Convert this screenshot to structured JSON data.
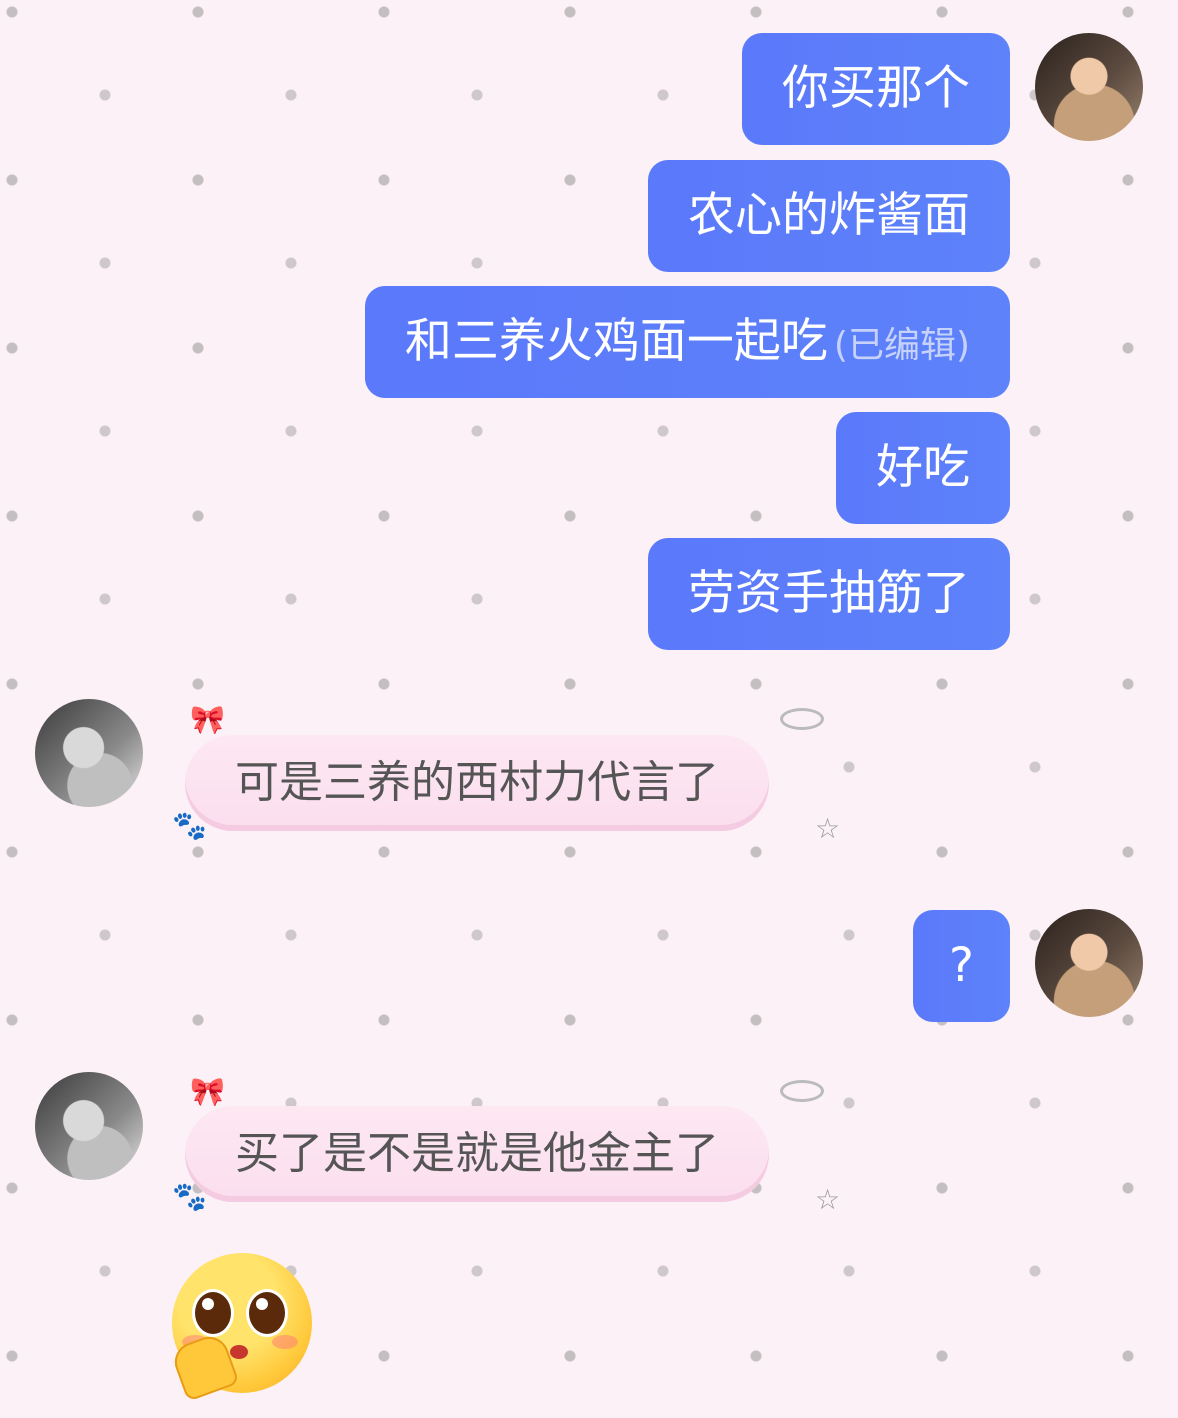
{
  "conversation": {
    "outgoing": [
      {
        "text": "你买那个"
      },
      {
        "text": "农心的炸酱面"
      },
      {
        "text": "和三养火鸡面一起吃",
        "edited_label": "(已编辑)"
      },
      {
        "text": "好吃"
      },
      {
        "text": "劳资手抽筋了"
      },
      {
        "text": "?"
      }
    ],
    "incoming": [
      {
        "text": "可是三养的西村力代言了"
      },
      {
        "text": "买了是不是就是他金主了"
      }
    ],
    "sticker": {
      "icon": "pleading-face-emoji"
    }
  },
  "colors": {
    "outgoing_bubble": "#5b79fb",
    "incoming_bubble": "#fde8f2",
    "background": "#fbf1f6"
  }
}
